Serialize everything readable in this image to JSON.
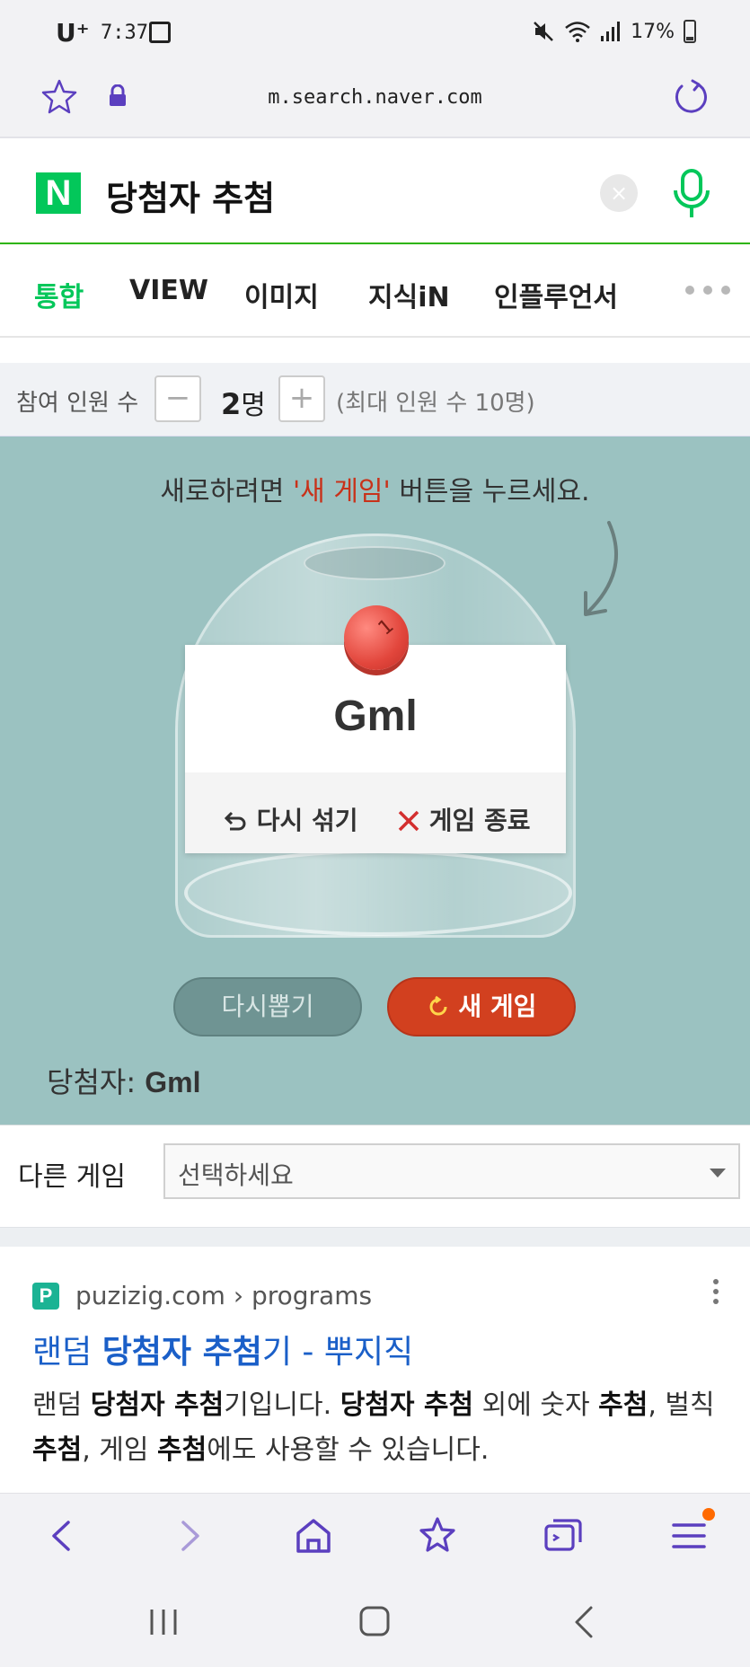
{
  "status_bar": {
    "carrier": "U⁺",
    "time": "7:37",
    "battery": "17%"
  },
  "browser": {
    "url": "m.search.naver.com"
  },
  "search": {
    "query": "당첨자 추첨",
    "logo": "N",
    "clear_label": "×"
  },
  "tabs": [
    {
      "label": "통합",
      "active": true
    },
    {
      "label": "VIEW"
    },
    {
      "label": "이미지"
    },
    {
      "label": "지식iN"
    },
    {
      "label": "인플루언서"
    }
  ],
  "participants": {
    "label": "참여 인원 수",
    "minus": "−",
    "plus": "+",
    "count": "2",
    "count_unit": "명",
    "max_note": "(최대 인원 수 10명)"
  },
  "game": {
    "hint_prefix": "새로하려면 ",
    "hint_highlight": "'새 게임'",
    "hint_suffix": " 버튼을 누르세요.",
    "ball_number": "1",
    "result_name": "Gml",
    "reshuffle_label": "다시 섞기",
    "end_label": "게임 종료",
    "redraw_label": "다시뽑기",
    "new_game_label": "새 게임",
    "winner_label": "당첨자:",
    "winner_name": "Gml"
  },
  "other_game": {
    "label": "다른 게임",
    "selected": "선택하세요"
  },
  "result": {
    "favicon": "P",
    "source": "puzizig.com › programs",
    "title_a": "랜덤 ",
    "title_b": "당첨자 추첨",
    "title_c": "기 - 뿌지직",
    "desc_1": "랜덤 ",
    "desc_2": "당첨자 추첨",
    "desc_3": "기입니다. ",
    "desc_4": "당첨자 추첨",
    "desc_5": " 외에 숫자 ",
    "desc_6": "추첨",
    "desc_7": ", 벌칙 ",
    "desc_8": "추첨",
    "desc_9": ", 게임 ",
    "desc_10": "추첨",
    "desc_11": "에도 사용할 수 있습니다."
  },
  "colors": {
    "naver_green": "#03c75a",
    "game_bg": "#9bc2c1",
    "new_game_red": "#d2401f",
    "link_blue": "#1a5fc8",
    "browser_purple": "#5b3fbf"
  }
}
